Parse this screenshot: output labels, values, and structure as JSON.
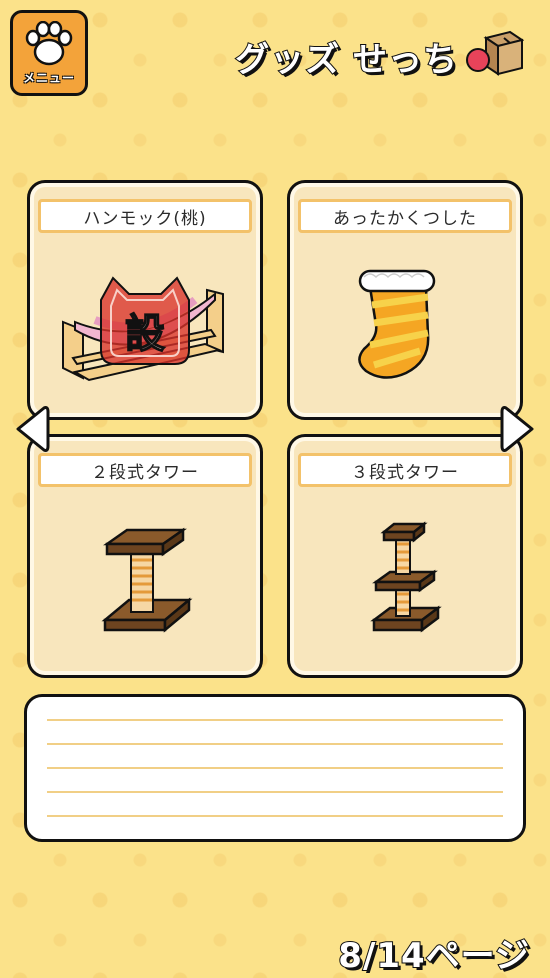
{
  "header": {
    "menu_label": "メニュー",
    "title": "グッズ せっち"
  },
  "items": [
    {
      "name": "ハンモック(桃)",
      "icon": "hammock-icon",
      "placed": true,
      "stamp_label": "設"
    },
    {
      "name": "あったかくつした",
      "icon": "sock-icon",
      "placed": false
    },
    {
      "name": "２段式タワー",
      "icon": "two-tier-tower-icon",
      "placed": false
    },
    {
      "name": "３段式タワー",
      "icon": "three-tier-tower-icon",
      "placed": false
    }
  ],
  "pager": {
    "text": "8/14ページ"
  },
  "colors": {
    "background": "#fbe28a",
    "accent_orange": "#f3a33a",
    "card_bg": "#f8e6bd",
    "stamp_red": "#d8322a"
  }
}
